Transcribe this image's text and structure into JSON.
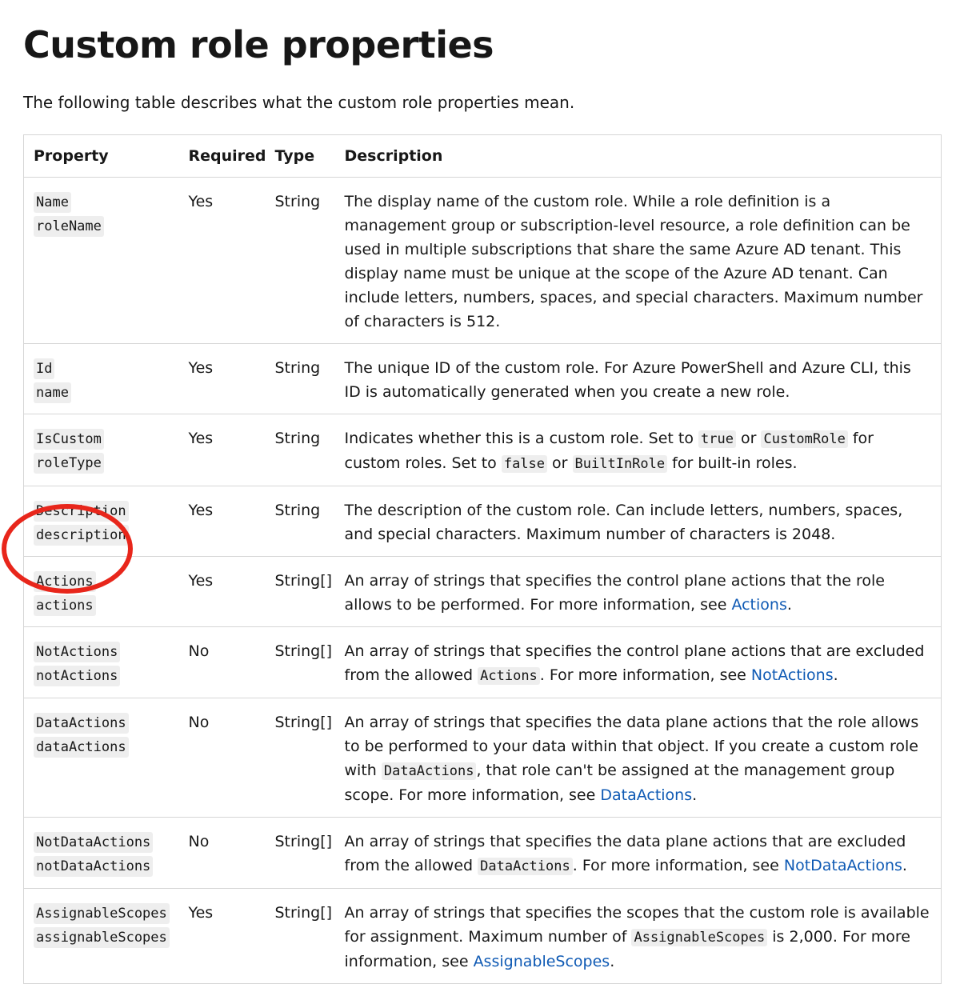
{
  "page": {
    "title": "Custom role properties",
    "intro": "The following table describes what the custom role properties mean."
  },
  "table": {
    "headers": {
      "property": "Property",
      "required": "Required",
      "type": "Type",
      "description": "Description"
    },
    "rows": [
      {
        "prop1": "Name",
        "prop2": "roleName",
        "required": "Yes",
        "type": "String",
        "desc": [
          {
            "t": "The display name of the custom role. While a role definition is a management group or subscription-level resource, a role definition can be used in multiple subscriptions that share the same Azure AD tenant. This display name must be unique at the scope of the Azure AD tenant. Can include letters, numbers, spaces, and special characters. Maximum number of characters is 512."
          }
        ]
      },
      {
        "prop1": "Id",
        "prop2": "name",
        "required": "Yes",
        "type": "String",
        "desc": [
          {
            "t": "The unique ID of the custom role. For Azure PowerShell and Azure CLI, this ID is automatically generated when you create a new role."
          }
        ]
      },
      {
        "prop1": "IsCustom",
        "prop2": "roleType",
        "required": "Yes",
        "type": "String",
        "desc": [
          {
            "t": "Indicates whether this is a custom role. Set to "
          },
          {
            "c": "true"
          },
          {
            "t": " or "
          },
          {
            "c": "CustomRole"
          },
          {
            "t": " for custom roles. Set to "
          },
          {
            "c": "false"
          },
          {
            "t": " or "
          },
          {
            "c": "BuiltInRole"
          },
          {
            "t": " for built-in roles."
          }
        ]
      },
      {
        "prop1": "Description",
        "prop2": "description",
        "required": "Yes",
        "type": "String",
        "desc": [
          {
            "t": "The description of the custom role. Can include letters, numbers, spaces, and special characters. Maximum number of characters is 2048."
          }
        ]
      },
      {
        "prop1": "Actions",
        "prop2": "actions",
        "required": "Yes",
        "type": "String[]",
        "desc": [
          {
            "t": "An array of strings that specifies the control plane actions that the role allows to be performed. For more information, see "
          },
          {
            "l": "Actions"
          },
          {
            "t": "."
          }
        ]
      },
      {
        "prop1": "NotActions",
        "prop2": "notActions",
        "required": "No",
        "type": "String[]",
        "desc": [
          {
            "t": "An array of strings that specifies the control plane actions that are excluded from the allowed "
          },
          {
            "c": "Actions"
          },
          {
            "t": ". For more information, see "
          },
          {
            "l": "NotActions"
          },
          {
            "t": "."
          }
        ]
      },
      {
        "prop1": "DataActions",
        "prop2": "dataActions",
        "required": "No",
        "type": "String[]",
        "desc": [
          {
            "t": "An array of strings that specifies the data plane actions that the role allows to be performed to your data within that object. If you create a custom role with "
          },
          {
            "c": "DataActions"
          },
          {
            "t": ", that role can't be assigned at the management group scope. For more information, see "
          },
          {
            "l": "DataActions"
          },
          {
            "t": "."
          }
        ]
      },
      {
        "prop1": "NotDataActions",
        "prop2": "notDataActions",
        "required": "No",
        "type": "String[]",
        "desc": [
          {
            "t": "An array of strings that specifies the data plane actions that are excluded from the allowed "
          },
          {
            "c": "DataActions"
          },
          {
            "t": ". For more information, see "
          },
          {
            "l": "NotDataActions"
          },
          {
            "t": "."
          }
        ]
      },
      {
        "prop1": "AssignableScopes",
        "prop2": "assignableScopes",
        "required": "Yes",
        "type": "String[]",
        "desc": [
          {
            "t": "An array of strings that specifies the scopes that the custom role is available for assignment. Maximum number of "
          },
          {
            "c": "AssignableScopes"
          },
          {
            "t": " is 2,000. For more information, see "
          },
          {
            "l": "AssignableScopes"
          },
          {
            "t": "."
          }
        ]
      }
    ]
  },
  "annotation": {
    "color": "#e8261b"
  },
  "colors": {
    "link": "#0f5ab4",
    "code_bg": "#eeeeee",
    "border": "#d6d6d6"
  }
}
